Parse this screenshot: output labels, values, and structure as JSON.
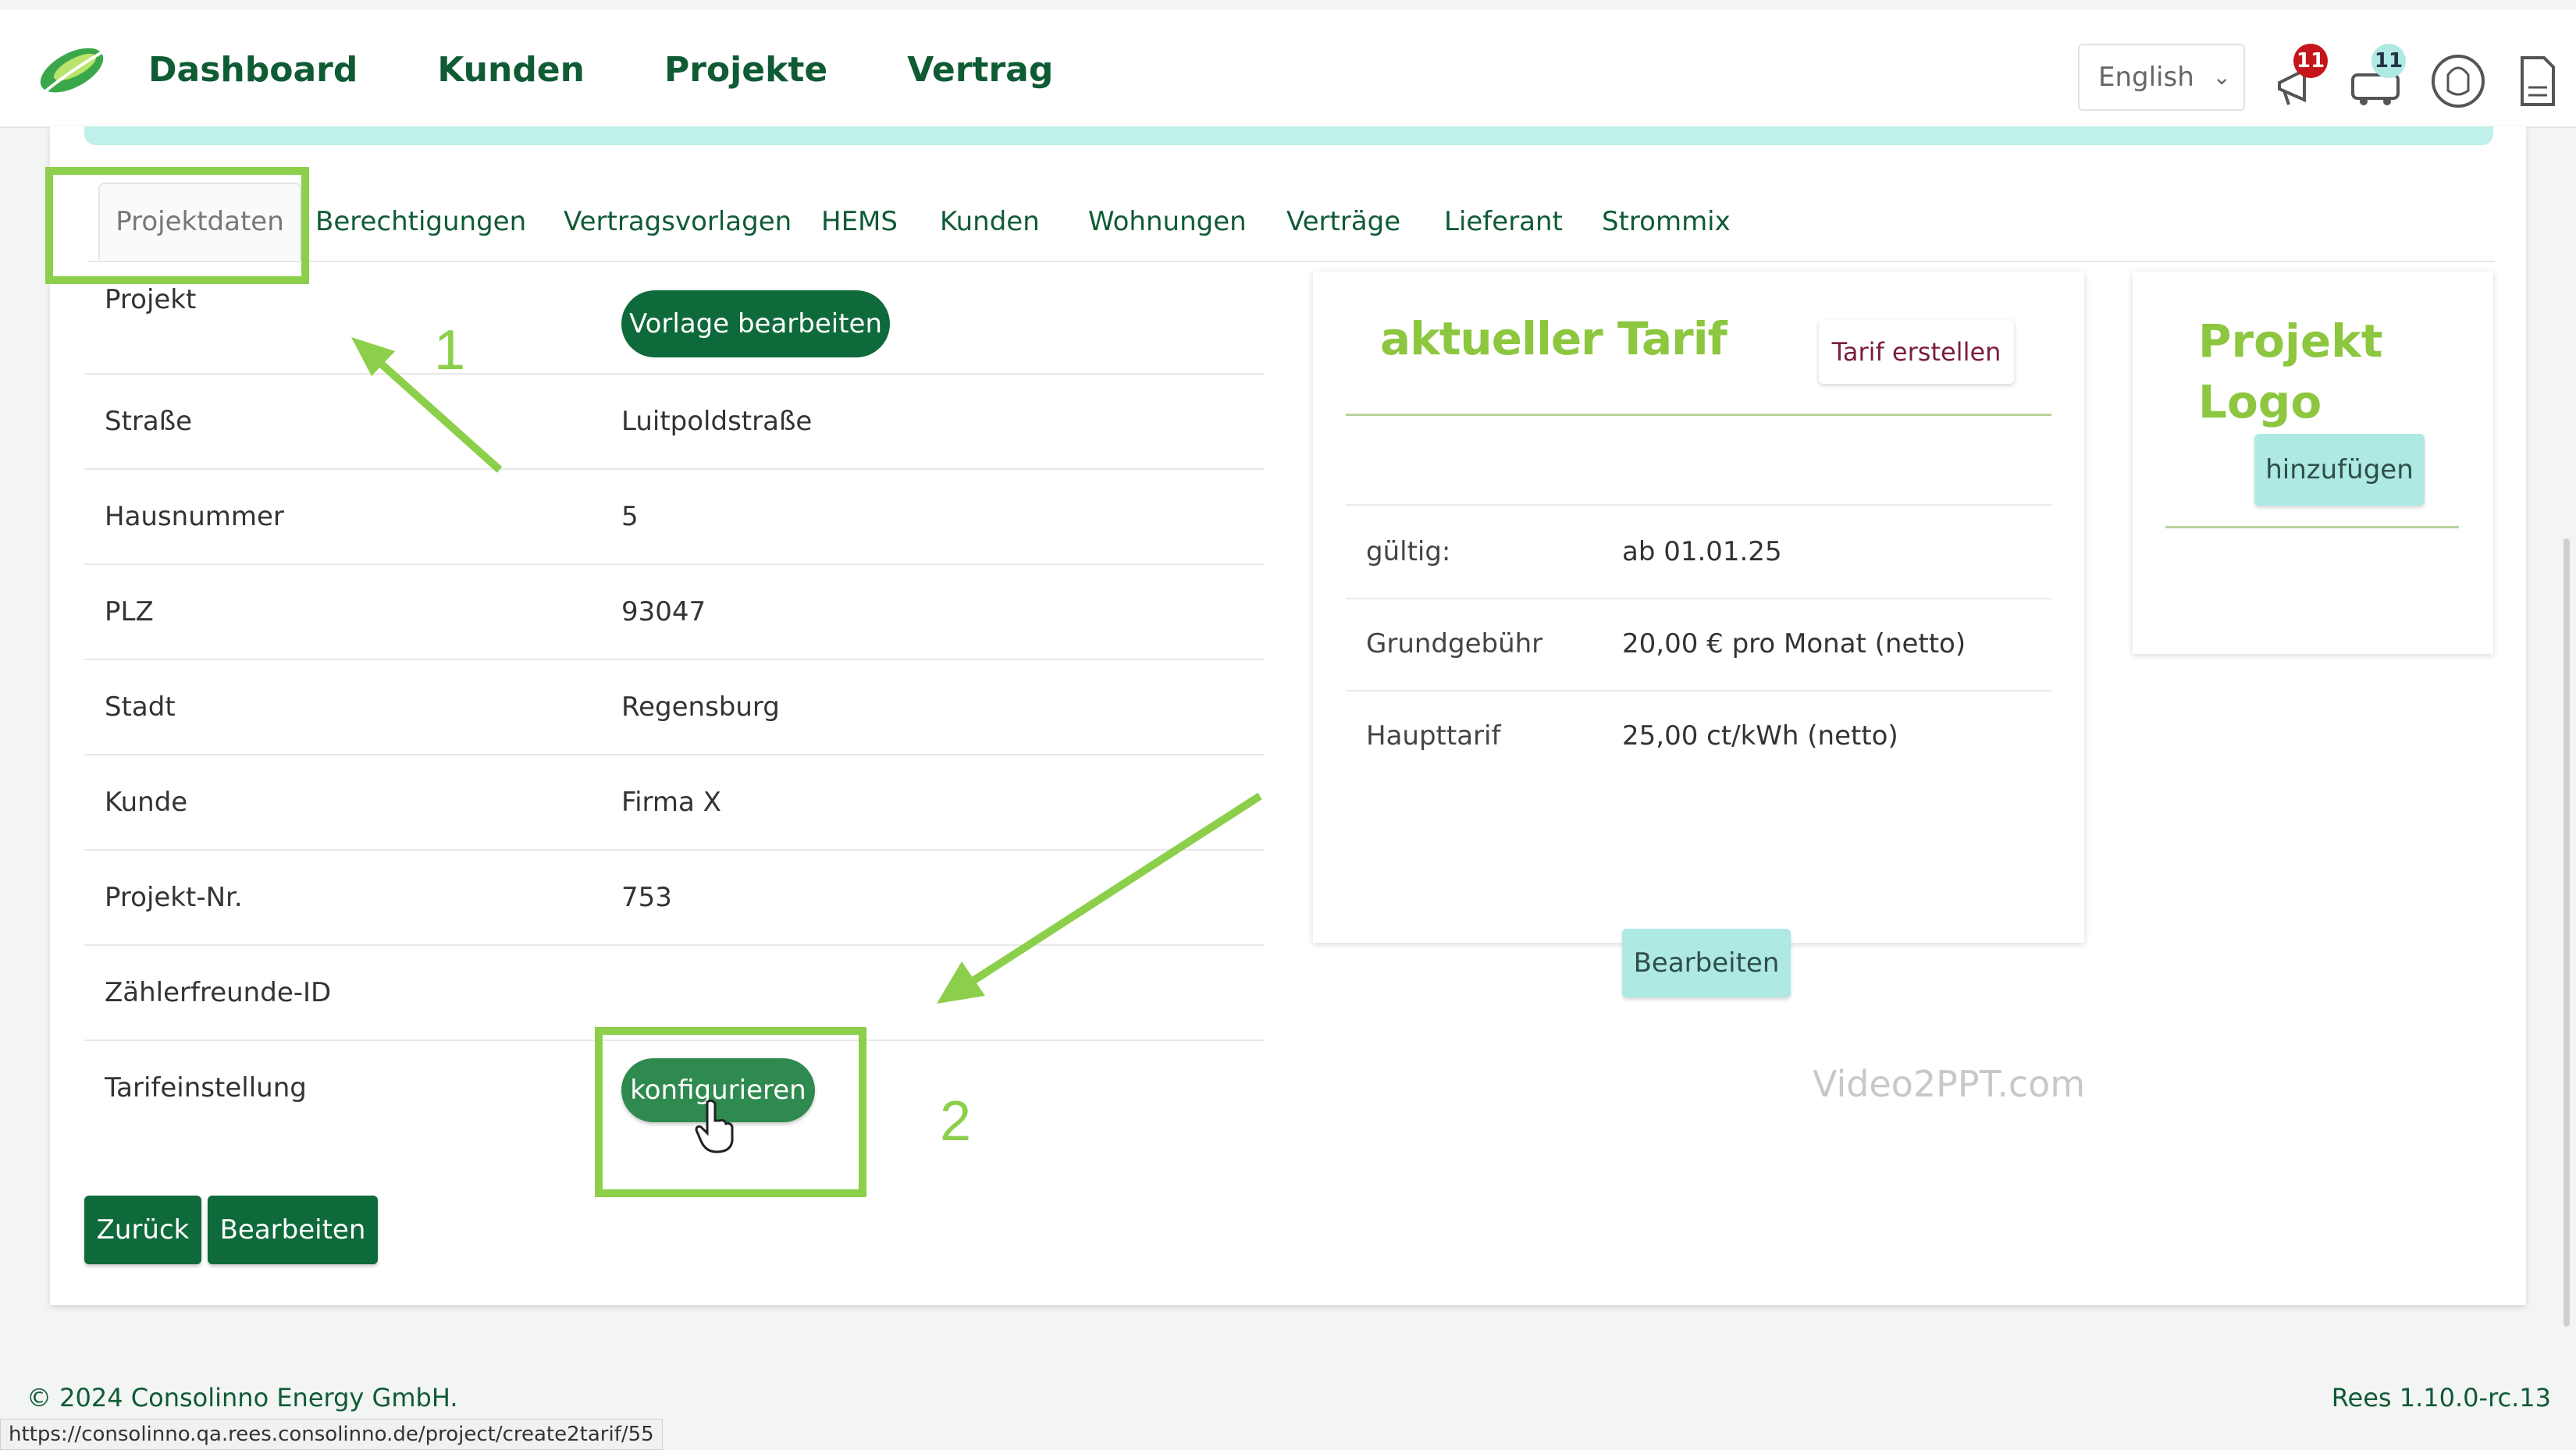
{
  "nav": {
    "items": [
      "Dashboard",
      "Kunden",
      "Projekte",
      "Vertrag"
    ]
  },
  "header": {
    "language": "English",
    "notifications_count": "11",
    "messages_count": "11"
  },
  "tabs": [
    "Projektdaten",
    "Berechtigungen",
    "Vertragsvorlagen",
    "HEMS",
    "Kunden",
    "Wohnungen",
    "Verträge",
    "Lieferant",
    "Strommix"
  ],
  "project": {
    "rows": [
      {
        "label": "Projekt",
        "value": ""
      },
      {
        "label": "Straße",
        "value": "Luitpoldstraße"
      },
      {
        "label": "Hausnummer",
        "value": "5"
      },
      {
        "label": "PLZ",
        "value": "93047"
      },
      {
        "label": "Stadt",
        "value": "Regensburg"
      },
      {
        "label": "Kunde",
        "value": "Firma X"
      },
      {
        "label": "Projekt-Nr.",
        "value": "753"
      },
      {
        "label": "Zählerfreunde-ID",
        "value": ""
      },
      {
        "label": "Tarifeinstellung",
        "value": ""
      }
    ],
    "edit_template_label": "Vorlage bearbeiten",
    "configure_label": "konfigurieren",
    "back_label": "Zurück",
    "edit_label": "Bearbeiten"
  },
  "tariff": {
    "title": "aktueller Tarif",
    "create_label": "Tarif erstellen",
    "rows": [
      {
        "label": "gültig:",
        "value": "ab 01.01.25"
      },
      {
        "label": "Grundgebühr",
        "value": "20,00 € pro Monat (netto)"
      },
      {
        "label": "Haupttarif",
        "value": "25,00 ct/kWh (netto)"
      }
    ],
    "edit_label": "Bearbeiten"
  },
  "logo_card": {
    "title_line1": "Projekt",
    "title_line2": "Logo",
    "add_label": "hinzufügen"
  },
  "annotations": {
    "one": "1",
    "two": "2",
    "color": "#8ccf4a"
  },
  "watermark": "Video2PPT.com",
  "footer": {
    "copyright": "© 2024 Consolinno Energy GmbH.",
    "version": "Rees 1.10.0-rc.13",
    "status_url": "https://consolinno.qa.rees.consolinno.de/project/create2tarif/55"
  },
  "colors": {
    "brand_green": "#0f5b34",
    "accent_green": "#8dc63f",
    "teal": "#aee9e4",
    "badge_red": "#c4161c"
  }
}
